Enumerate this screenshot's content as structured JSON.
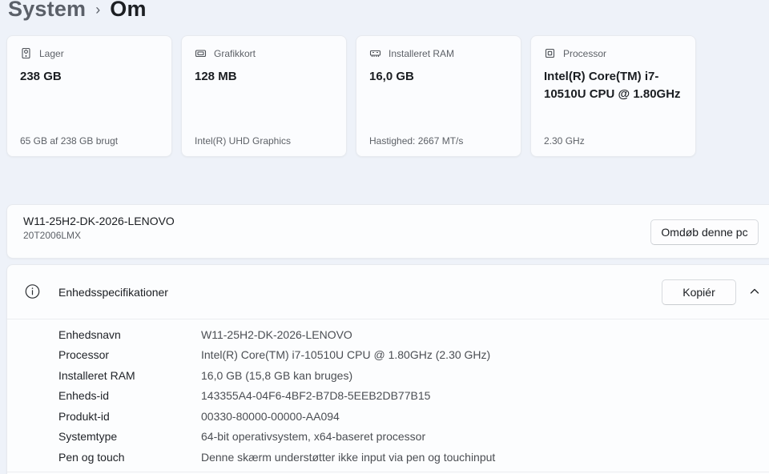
{
  "breadcrumb": {
    "parent": "System",
    "separator": "›",
    "current": "Om"
  },
  "cards": [
    {
      "label": "Lager",
      "value": "238 GB",
      "footer": "65 GB af 238 GB brugt"
    },
    {
      "label": "Grafikkort",
      "value": "128 MB",
      "footer": "Intel(R) UHD Graphics"
    },
    {
      "label": "Installeret RAM",
      "value": "16,0 GB",
      "footer": "Hastighed: 2667 MT/s"
    },
    {
      "label": "Processor",
      "value": "Intel(R) Core(TM) i7-10510U CPU @ 1.80GHz",
      "footer": "2.30 GHz"
    }
  ],
  "device": {
    "name": "W11-25H2-DK-2026-LENOVO",
    "model": "20T2006LMX",
    "rename_button_label": "Omdøb denne pc"
  },
  "specs": {
    "title": "Enhedsspecifikationer",
    "copy_button_label": "Kopiér",
    "rows": [
      {
        "label": "Enhedsnavn",
        "value": "W11-25H2-DK-2026-LENOVO"
      },
      {
        "label": "Processor",
        "value": "Intel(R) Core(TM) i7-10510U CPU @ 1.80GHz (2.30 GHz)"
      },
      {
        "label": "Installeret RAM",
        "value": "16,0 GB (15,8 GB kan bruges)"
      },
      {
        "label": "Enheds-id",
        "value": "143355A4-04F6-4BF2-B7D8-5EEB2DB77B15"
      },
      {
        "label": "Produkt-id",
        "value": "00330-80000-00000-AA094"
      },
      {
        "label": "Systemtype",
        "value": "64-bit operativsystem, x64-baseret processor"
      },
      {
        "label": "Pen og touch",
        "value": "Denne skærm understøtter ikke input via pen og touchinput"
      }
    ]
  },
  "colors": {
    "page_background": "#eef2f9",
    "card_background": "#fbfcfe",
    "card_border": "#e7eaef",
    "text_primary": "#1a1d21",
    "text_secondary": "#5d6167"
  }
}
